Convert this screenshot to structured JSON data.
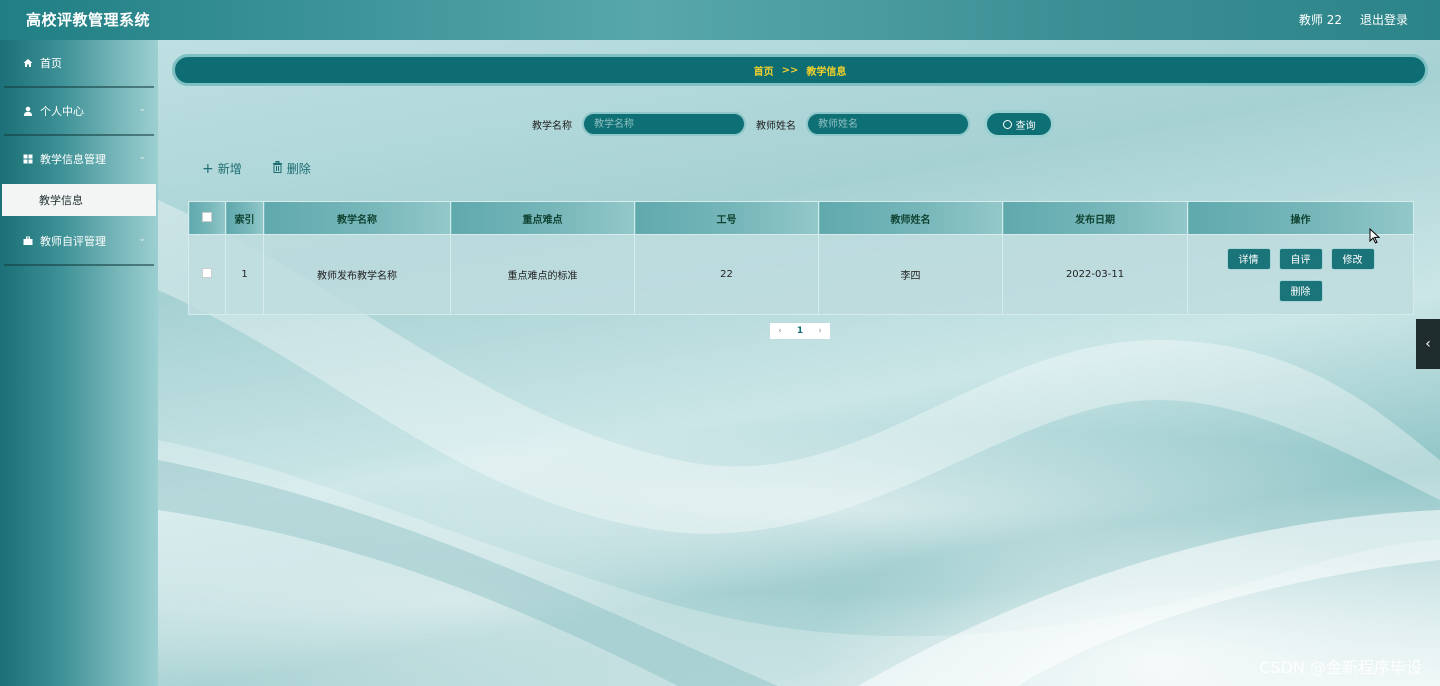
{
  "header": {
    "title": "高校评教管理系统",
    "user": "教师 22",
    "logout": "退出登录"
  },
  "sidebar": {
    "items": [
      {
        "label": "首页",
        "icon": "home-icon"
      },
      {
        "label": "个人中心",
        "icon": "user-icon"
      },
      {
        "label": "教学信息管理",
        "icon": "grid-icon",
        "sub": "教学信息"
      },
      {
        "label": "教师自评管理",
        "icon": "briefcase-icon"
      }
    ]
  },
  "breadcrumb": {
    "home": "首页",
    "sep": ">>",
    "current": "教学信息"
  },
  "search": {
    "field1_label": "教学名称",
    "field1_placeholder": "教学名称",
    "field2_label": "教师姓名",
    "field2_placeholder": "教师姓名",
    "query": "查询"
  },
  "toolbar": {
    "add": "新增",
    "delete": "删除"
  },
  "table": {
    "columns": [
      "索引",
      "教学名称",
      "重点难点",
      "工号",
      "教师姓名",
      "发布日期",
      "操作"
    ],
    "rows": [
      {
        "index": "1",
        "name": "教师发布教学名称",
        "focus": "重点难点的标准",
        "id": "22",
        "teacher": "李四",
        "date": "2022-03-11"
      }
    ],
    "ops": {
      "detail": "详情",
      "self_eval": "自评",
      "edit": "修改",
      "delete": "删除"
    }
  },
  "pagination": {
    "prev": "‹",
    "current": "1",
    "next": "›"
  },
  "watermark": "CSDN @金新程序毕设",
  "colors": {
    "primary": "#0e6f74",
    "accent": "#f1d02c"
  }
}
